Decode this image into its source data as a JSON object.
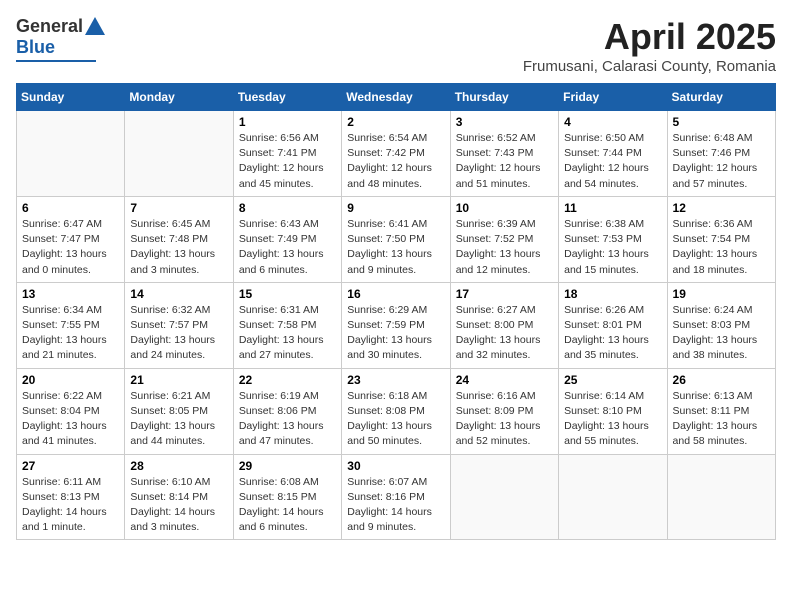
{
  "header": {
    "logo": {
      "line1": "General",
      "line2": "Blue"
    },
    "title": "April 2025",
    "location": "Frumusani, Calarasi County, Romania"
  },
  "calendar": {
    "weekdays": [
      "Sunday",
      "Monday",
      "Tuesday",
      "Wednesday",
      "Thursday",
      "Friday",
      "Saturday"
    ],
    "weeks": [
      [
        {
          "day": "",
          "detail": ""
        },
        {
          "day": "",
          "detail": ""
        },
        {
          "day": "1",
          "detail": "Sunrise: 6:56 AM\nSunset: 7:41 PM\nDaylight: 12 hours\nand 45 minutes."
        },
        {
          "day": "2",
          "detail": "Sunrise: 6:54 AM\nSunset: 7:42 PM\nDaylight: 12 hours\nand 48 minutes."
        },
        {
          "day": "3",
          "detail": "Sunrise: 6:52 AM\nSunset: 7:43 PM\nDaylight: 12 hours\nand 51 minutes."
        },
        {
          "day": "4",
          "detail": "Sunrise: 6:50 AM\nSunset: 7:44 PM\nDaylight: 12 hours\nand 54 minutes."
        },
        {
          "day": "5",
          "detail": "Sunrise: 6:48 AM\nSunset: 7:46 PM\nDaylight: 12 hours\nand 57 minutes."
        }
      ],
      [
        {
          "day": "6",
          "detail": "Sunrise: 6:47 AM\nSunset: 7:47 PM\nDaylight: 13 hours\nand 0 minutes."
        },
        {
          "day": "7",
          "detail": "Sunrise: 6:45 AM\nSunset: 7:48 PM\nDaylight: 13 hours\nand 3 minutes."
        },
        {
          "day": "8",
          "detail": "Sunrise: 6:43 AM\nSunset: 7:49 PM\nDaylight: 13 hours\nand 6 minutes."
        },
        {
          "day": "9",
          "detail": "Sunrise: 6:41 AM\nSunset: 7:50 PM\nDaylight: 13 hours\nand 9 minutes."
        },
        {
          "day": "10",
          "detail": "Sunrise: 6:39 AM\nSunset: 7:52 PM\nDaylight: 13 hours\nand 12 minutes."
        },
        {
          "day": "11",
          "detail": "Sunrise: 6:38 AM\nSunset: 7:53 PM\nDaylight: 13 hours\nand 15 minutes."
        },
        {
          "day": "12",
          "detail": "Sunrise: 6:36 AM\nSunset: 7:54 PM\nDaylight: 13 hours\nand 18 minutes."
        }
      ],
      [
        {
          "day": "13",
          "detail": "Sunrise: 6:34 AM\nSunset: 7:55 PM\nDaylight: 13 hours\nand 21 minutes."
        },
        {
          "day": "14",
          "detail": "Sunrise: 6:32 AM\nSunset: 7:57 PM\nDaylight: 13 hours\nand 24 minutes."
        },
        {
          "day": "15",
          "detail": "Sunrise: 6:31 AM\nSunset: 7:58 PM\nDaylight: 13 hours\nand 27 minutes."
        },
        {
          "day": "16",
          "detail": "Sunrise: 6:29 AM\nSunset: 7:59 PM\nDaylight: 13 hours\nand 30 minutes."
        },
        {
          "day": "17",
          "detail": "Sunrise: 6:27 AM\nSunset: 8:00 PM\nDaylight: 13 hours\nand 32 minutes."
        },
        {
          "day": "18",
          "detail": "Sunrise: 6:26 AM\nSunset: 8:01 PM\nDaylight: 13 hours\nand 35 minutes."
        },
        {
          "day": "19",
          "detail": "Sunrise: 6:24 AM\nSunset: 8:03 PM\nDaylight: 13 hours\nand 38 minutes."
        }
      ],
      [
        {
          "day": "20",
          "detail": "Sunrise: 6:22 AM\nSunset: 8:04 PM\nDaylight: 13 hours\nand 41 minutes."
        },
        {
          "day": "21",
          "detail": "Sunrise: 6:21 AM\nSunset: 8:05 PM\nDaylight: 13 hours\nand 44 minutes."
        },
        {
          "day": "22",
          "detail": "Sunrise: 6:19 AM\nSunset: 8:06 PM\nDaylight: 13 hours\nand 47 minutes."
        },
        {
          "day": "23",
          "detail": "Sunrise: 6:18 AM\nSunset: 8:08 PM\nDaylight: 13 hours\nand 50 minutes."
        },
        {
          "day": "24",
          "detail": "Sunrise: 6:16 AM\nSunset: 8:09 PM\nDaylight: 13 hours\nand 52 minutes."
        },
        {
          "day": "25",
          "detail": "Sunrise: 6:14 AM\nSunset: 8:10 PM\nDaylight: 13 hours\nand 55 minutes."
        },
        {
          "day": "26",
          "detail": "Sunrise: 6:13 AM\nSunset: 8:11 PM\nDaylight: 13 hours\nand 58 minutes."
        }
      ],
      [
        {
          "day": "27",
          "detail": "Sunrise: 6:11 AM\nSunset: 8:13 PM\nDaylight: 14 hours\nand 1 minute."
        },
        {
          "day": "28",
          "detail": "Sunrise: 6:10 AM\nSunset: 8:14 PM\nDaylight: 14 hours\nand 3 minutes."
        },
        {
          "day": "29",
          "detail": "Sunrise: 6:08 AM\nSunset: 8:15 PM\nDaylight: 14 hours\nand 6 minutes."
        },
        {
          "day": "30",
          "detail": "Sunrise: 6:07 AM\nSunset: 8:16 PM\nDaylight: 14 hours\nand 9 minutes."
        },
        {
          "day": "",
          "detail": ""
        },
        {
          "day": "",
          "detail": ""
        },
        {
          "day": "",
          "detail": ""
        }
      ]
    ]
  }
}
